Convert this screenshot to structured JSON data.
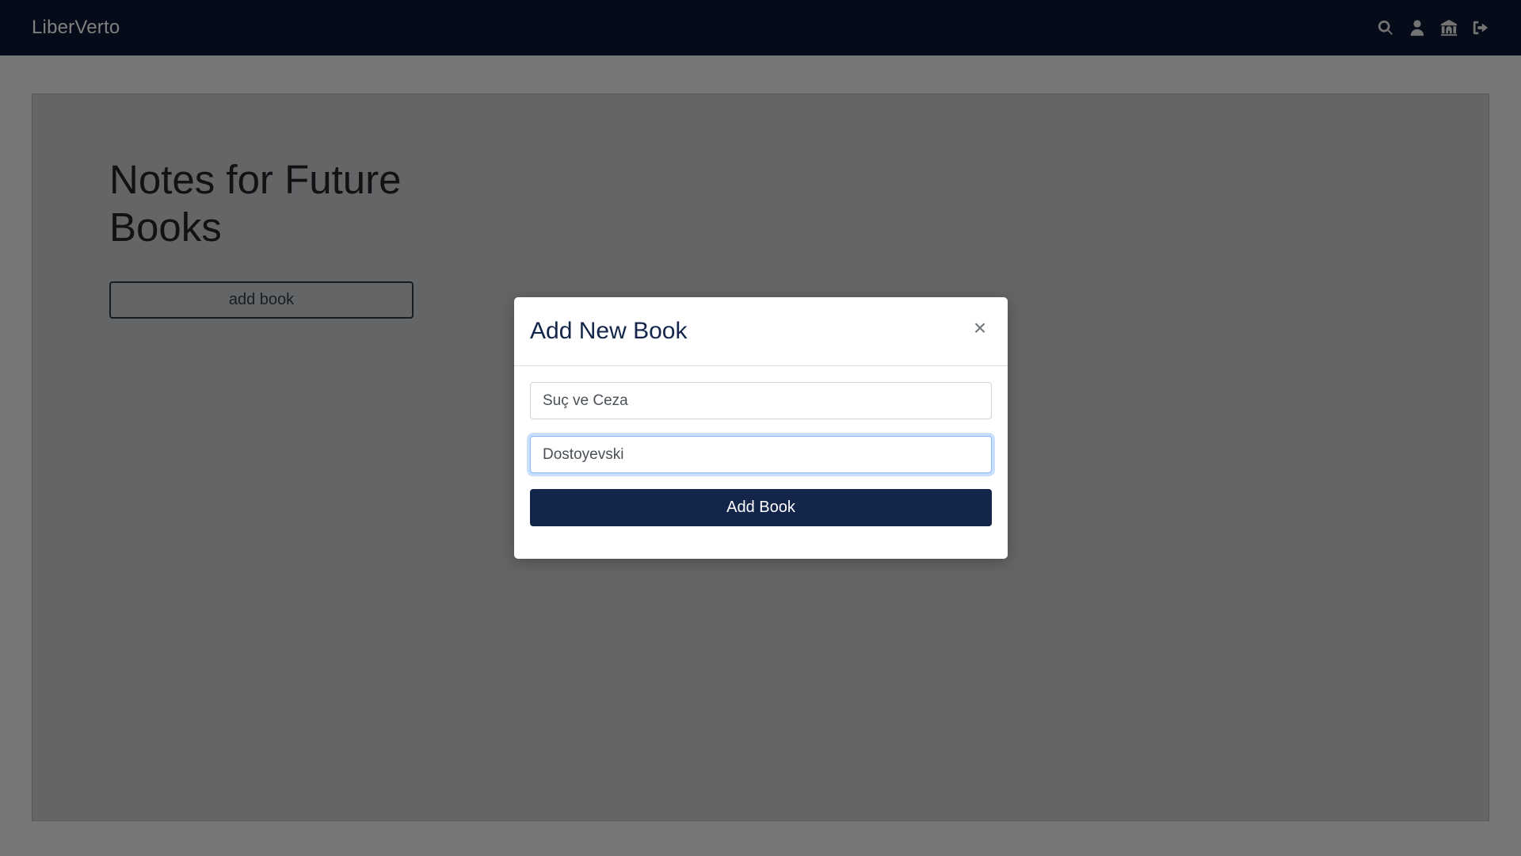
{
  "navbar": {
    "brand": "LiberVerto",
    "icons": [
      "search-icon",
      "user-icon",
      "library-icon",
      "logout-icon"
    ]
  },
  "page": {
    "title": "Notes for Future Books",
    "add_button_label": "add book"
  },
  "modal": {
    "title": "Add New Book",
    "close_symbol": "×",
    "book_name_value": "Suç ve Ceza",
    "author_value": "Dostoyevski",
    "submit_label": "Add Book"
  },
  "colors": {
    "navbar_bg": "#0a1631",
    "primary": "#14254a",
    "backdrop": "rgba(0,0,0,0.5)"
  }
}
